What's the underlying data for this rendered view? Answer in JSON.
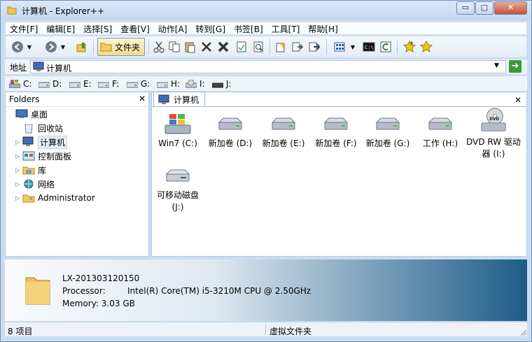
{
  "window": {
    "title": "计算机 - Explorer++",
    "controls": {
      "minimize": "▭",
      "maximize": "▢",
      "close": "✕"
    }
  },
  "menu": [
    "文件[F]",
    "编辑[E]",
    "选择[S]",
    "查看[V]",
    "动作[A]",
    "转到[G]",
    "书签[B]",
    "工具[T]",
    "帮助[H]"
  ],
  "toolbar": {
    "folders_label": "文件夹"
  },
  "address": {
    "label": "地址",
    "value": "计算机"
  },
  "drives": [
    "C:",
    "D:",
    "E:",
    "F:",
    "G:",
    "H:",
    "I:",
    "J:"
  ],
  "tree": {
    "header": "Folders",
    "items": [
      {
        "label": "桌面",
        "icon": "desktop-icon",
        "expander": ""
      },
      {
        "label": "回收站",
        "icon": "recycle-bin-icon",
        "expander": ""
      },
      {
        "label": "计算机",
        "icon": "computer-icon",
        "expander": "▷"
      },
      {
        "label": "控制面板",
        "icon": "control-panel-icon",
        "expander": "▷"
      },
      {
        "label": "库",
        "icon": "library-icon",
        "expander": "▷"
      },
      {
        "label": "网络",
        "icon": "network-icon",
        "expander": "▷"
      },
      {
        "label": "Administrator",
        "icon": "user-folder-icon",
        "expander": "▷"
      }
    ]
  },
  "content": {
    "tab_label": "计算机",
    "items": [
      {
        "label": "Win7 (C:)",
        "icon": "windows-drive-icon"
      },
      {
        "label": "新加卷 (D:)",
        "icon": "hard-drive-icon"
      },
      {
        "label": "新加卷 (E:)",
        "icon": "hard-drive-icon"
      },
      {
        "label": "新加卷 (F:)",
        "icon": "hard-drive-icon"
      },
      {
        "label": "新加卷 (G:)",
        "icon": "hard-drive-icon"
      },
      {
        "label": "工作 (H:)",
        "icon": "hard-drive-icon"
      },
      {
        "label": "DVD RW 驱动器 (I:)",
        "icon": "dvd-drive-icon"
      },
      {
        "label": "可移动磁盘 (J:)",
        "icon": "removable-drive-icon"
      }
    ]
  },
  "details": {
    "name": "LX-201303120150",
    "processor_label": "Processor:",
    "processor_value": "Intel(R) Core(TM) i5-3210M CPU @ 2.50GHz",
    "memory": "Memory: 3.03 GB"
  },
  "status": {
    "count": "8 项目",
    "type": "虚拟文件夹"
  }
}
